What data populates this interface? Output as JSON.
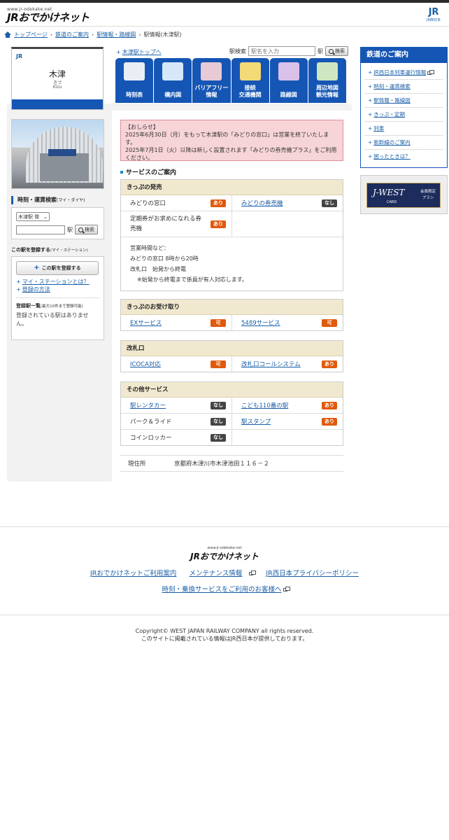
{
  "header": {
    "logo_url": "www.jr-odekake.net",
    "logo_text": "JRおでかけネット",
    "brand_mark": "JR",
    "brand_sub": "JR西日本"
  },
  "breadcrumb": [
    "トップページ",
    "鉄道のご案内",
    "駅情報・路線図",
    "駅情報(木津駅)"
  ],
  "station": {
    "name": "木津",
    "kana": "きづ",
    "romaji": "Kizu",
    "jr_mark": "JR",
    "top_link": "木津駅トップへ"
  },
  "search": {
    "label": "駅検索",
    "placeholder": "駅名を入力",
    "suffix": "駅",
    "button": "検索"
  },
  "tabs": [
    {
      "label": "時刻表",
      "color": "#e9eef5"
    },
    {
      "label": "構内図",
      "color": "#d6e8f7"
    },
    {
      "label": "バリアフリー\n情報",
      "color": "#e8c9d6"
    },
    {
      "label": "接続\n交通機関",
      "color": "#f4d977"
    },
    {
      "label": "路線図",
      "color": "#d9c1e9"
    },
    {
      "label": "周辺地図\n観光情報",
      "color": "#cfe6c2"
    }
  ],
  "sidebar": {
    "timetable_title": "時刻・運賃検索",
    "timetable_sub": "(マイ・ダイヤ)",
    "select_value": "木津駅 発",
    "station_suffix": "駅",
    "search_button": "検索",
    "register_title": "この駅を登録する",
    "register_sub": "(マイ・ステーション)",
    "register_button": "この駅を登録する",
    "link_about": "マイ・ステーションとは？",
    "link_howto": "登録の方法",
    "list_title": "登録駅一覧",
    "list_sub": "(最大10件まで登録可能)",
    "empty_text": "登録されている駅はありません。"
  },
  "notice": {
    "title": "【おしらせ】",
    "line1": "2025年6月30日（月）をもって木津駅の「みどりの窓口」は営業を終了いたします。",
    "line2": "2025年7月1日（火）以降は新しく設置されます「みどりの券売機プラス」をご利用ください。"
  },
  "services": {
    "heading": "サービスのご案内",
    "ticket_sales": {
      "title": "きっぷの発売",
      "midori_window": "みどりの窓口",
      "midori_window_status": "あり",
      "midori_machine": "みどりの券売機",
      "midori_machine_status": "なし",
      "pass_machine": "定期券がお求めになれる券売機",
      "pass_machine_status": "あり",
      "hours_title": "営業時間など：",
      "hours_midori": "みどりの窓口 8時から20時",
      "hours_gate": "改札口　始発から終電",
      "hours_note": "※始発から終電まで係員が有人対応します。"
    },
    "ticket_pickup": {
      "title": "きっぷのお受け取り",
      "ex": "EXサービス",
      "ex_status": "可",
      "s5489": "5489サービス",
      "s5489_status": "可"
    },
    "gate": {
      "title": "改札口",
      "icoca": "ICOCA対応",
      "icoca_status": "可",
      "call": "改札口コールシステム",
      "call_status": "あり"
    },
    "other": {
      "title": "その他サービス",
      "rental": "駅レンタカー",
      "rental_status": "なし",
      "kodomo": "こども110番の駅",
      "kodomo_status": "あり",
      "park": "パーク＆ライド",
      "park_status": "なし",
      "stamp": "駅スタンプ",
      "stamp_status": "あり",
      "locker": "コインロッカー",
      "locker_status": "なし"
    }
  },
  "address": {
    "label": "現住所",
    "value": "京都府木津川市木津池田１１６－２"
  },
  "right": {
    "title": "鉄道のご案内",
    "items": [
      "JR西日本列車運行情報",
      "時刻・運賃検索",
      "駅情報・路線図",
      "きっぷ・定期",
      "列車",
      "新幹線のご案内",
      "困ったときは？"
    ],
    "card_logo": "J-WEST",
    "card_sub": "CARD",
    "card_plan": "会員限定\nプラン"
  },
  "footer": {
    "logo_url": "www.jr-odekake.net",
    "logo_text": "JRおでかけネット",
    "link1": "JRおでかけネットご利用案内",
    "link2": "メンテナンス情報",
    "link3": "JR西日本プライバシーポリシー",
    "link4": "時刻・乗換サービスをご利用のお客様へ",
    "copyright": "Copyright© WEST JAPAN RAILWAY COMPANY all rights reserved.",
    "provider": "このサイトに掲載されている情報はJR西日本が提供しております。"
  }
}
